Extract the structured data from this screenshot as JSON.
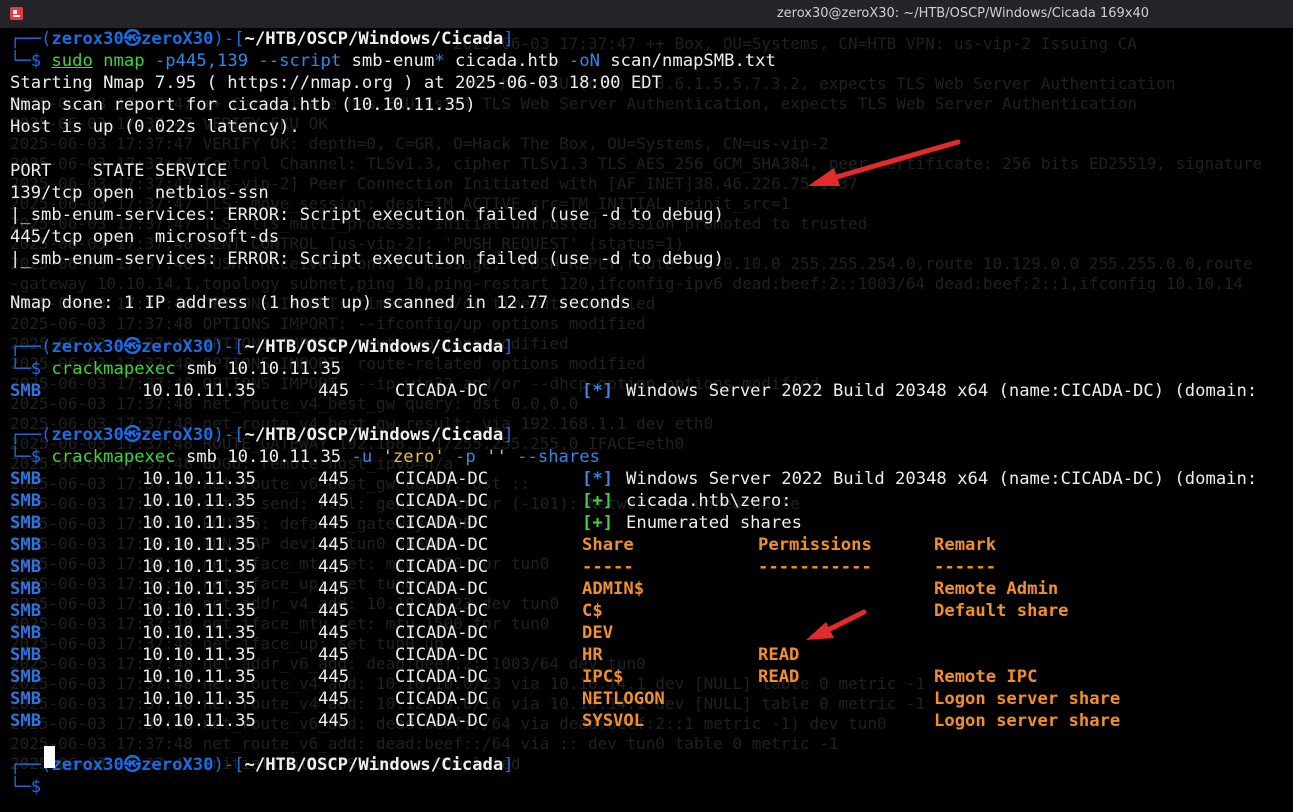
{
  "window": {
    "title": "zerox30@zeroX30: ~/HTB/OSCP/Windows/Cicada 169x40"
  },
  "prompt": {
    "open": "┌──(",
    "user": "zerox30㉿zeroX30",
    "mid": ")-[",
    "path": "~/HTB/OSCP/Windows/Cicada",
    "close": "]",
    "input": "└─$"
  },
  "block1": {
    "cmd_sudo": "sudo",
    "cmd_nmap": "nmap",
    "cmd_opt1": "-p445,139",
    "cmd_opt2": "--script",
    "cmd_arg1": "smb-enum",
    "cmd_glob": "*",
    "cmd_arg2": "cicada.htb",
    "cmd_opt3": "-oN",
    "cmd_arg3": "scan/nmapSMB.txt",
    "output": [
      "Starting Nmap 7.95 ( https://nmap.org ) at 2025-06-03 18:00 EDT",
      "Nmap scan report for cicada.htb (10.10.11.35)",
      "Host is up (0.022s latency).",
      "",
      "PORT    STATE SERVICE",
      "139/tcp open  netbios-ssn",
      "|_smb-enum-services: ERROR: Script execution failed (use -d to debug)",
      "445/tcp open  microsoft-ds",
      "|_smb-enum-services: ERROR: Script execution failed (use -d to debug)",
      "",
      "Nmap done: 1 IP address (1 host up) scanned in 12.77 seconds",
      ""
    ]
  },
  "block2": {
    "cmd_name": "crackmapexec",
    "cmd_args": "smb 10.10.11.35",
    "line": {
      "proto": "SMB",
      "ip": "10.10.11.35",
      "port": "445",
      "host": "CICADA-DC",
      "tag": "[*]",
      "msg": "Windows Server 2022 Build 20348 x64 (name:CICADA-DC) (domain:"
    }
  },
  "block3": {
    "cmd_name": "crackmapexec",
    "cmd_args": "smb 10.10.11.35",
    "cmd_opt_u": "-u",
    "cmd_user": "'zero'",
    "cmd_opt_p": "-p",
    "cmd_pass": "''",
    "cmd_opt_shares": "--shares",
    "proto": "SMB",
    "ip": "10.10.11.35",
    "port": "445",
    "host": "CICADA-DC",
    "info": [
      {
        "tag": "[*]",
        "msg": "Windows Server 2022 Build 20348 x64 (name:CICADA-DC) (domain:"
      },
      {
        "tag": "[+]",
        "msg": "cicada.htb\\zero:"
      },
      {
        "tag": "[+]",
        "msg": "Enumerated shares"
      }
    ],
    "headers": {
      "share": "Share",
      "perm": "Permissions",
      "remark": "Remark"
    },
    "dashes": {
      "share": "-----",
      "perm": "-----------",
      "remark": "------"
    },
    "shares": [
      {
        "name": "ADMIN$",
        "perm": "",
        "remark": "Remote Admin"
      },
      {
        "name": "C$",
        "perm": "",
        "remark": "Default share"
      },
      {
        "name": "DEV",
        "perm": "",
        "remark": ""
      },
      {
        "name": "HR",
        "perm": "READ",
        "remark": ""
      },
      {
        "name": "IPC$",
        "perm": "READ",
        "remark": "Remote IPC"
      },
      {
        "name": "NETLOGON",
        "perm": "",
        "remark": "Logon server share"
      },
      {
        "name": "SYSVOL",
        "perm": "",
        "remark": "Logon server share"
      }
    ]
  },
  "background_log": [
    "                                              2025-06-03 17:37:47 ++ Box, OU=Systems, CN=HTB VPN: us-vip-2 Issuing CA",
    "",
    "                                               ate has EKU (oid) 1.3.6.1.5.5.7.3.2, expects TLS Web Server Authentication",
    "2025-06-03 17:37:47 ++ Certificate has EKU (str) TLS Web Server Authentication, expects TLS Web Server Authentication",
    "2025-06-03 17:37:47 VERIFY EKU OK",
    "2025-06-03 17:37:47 VERIFY OK: depth=0, C=GR, O=Hack The Box, OU=Systems, CN=us-vip-2",
    "2025-06-03 17:37:47 Control Channel: TLSv1.3, cipher TLSv1.3 TLS_AES_256_GCM_SHA384, peer certificate: 256 bits ED25519, signature",
    "2025-06-03 17:37:47 [us-vip-2] Peer Connection Initiated with [AF_INET]38.46.226.75:1337",
    "2025-06-03 17:37:47 TLS: move_session: dest=TM_ACTIVE src=TM_INITIAL reinit_src=1",
    "2025-06-03 17:37:47 TLS: tls_multi_process: initial untrusted session promoted to trusted",
    "2025-06-03 17:37:48 SENT CONTROL [us-vip-2]: 'PUSH_REQUEST' (status=1)",
    "2025-06-03 17:37:48 PUSH: Received control message: 'PUSH_REPLY,route 10.10.10.0 255.255.254.0,route 10.129.0.0 255.255.0.0,route",
    "-gateway 10.10.14.1,topology subnet,ping 10,ping-restart 120,ifconfig-ipv6 dead:beef:2::1003/64 dead:beef:2::1,ifconfig 10.10.14",
    "2025-06-03 17:37:48 OPTIONS IMPORT: timers and/or timeouts modified",
    "2025-06-03 17:37:48 OPTIONS IMPORT: --ifconfig/up options modified",
    "2025-06-03 17:37:48 OPTIONS IMPORT: route options modified",
    "2025-06-03 17:37:48 OPTIONS IMPORT: route-related options modified",
    "2025-06-03 17:37:48 OPTIONS IMPORT: --ip-win32 and/or --dhcp-option options modified",
    "2025-06-03 17:37:48 net_route_v4_best_gw query: dst 0.0.0.0",
    "2025-06-03 17:37:48 net_route_v4_best_gw result: via 192.168.1.1 dev eth0",
    "2025-06-03 17:37:48 ROUTE_GATEWAY 192.168.1.1/255.255.255.0 IFACE=eth0",
    "2025-06-03 17:37:48 GDG6: remote_host_ipv6=n/a",
    "2025-06-03 17:37:48 net_route_v6_best_gw query: dst ::",
    "2025-06-03 17:37:48 sitnl_send: rtnl: generic error (-101): Network is unreachable",
    "2025-06-03 17:37:48 ROUTE6: default_gateway=UNDEF",
    "2025-06-03 17:37:48 TUN/TAP device tun0 opened",
    "2025-06-03 17:37:48 net_iface_mtu_set: mtu 1500 for tun0",
    "2025-06-03 17:37:48 net_iface_up: set tun0 up",
    "2025-06-03 17:37:48 net_addr_v4_add: 10.10.14.23 dev tun0",
    "2025-06-03 17:37:48 net_iface_mtu_set: mtu 1500 for tun0",
    "2025-06-03 17:37:48 net_iface_up: set tun0 up",
    "2025-06-03 17:37:48 net_addr_v6_add: dead:beef:2::1003/64 dev tun0",
    "2025-06-03 17:37:48 net_route_v4_add: 10.10.10.0/23 via 10.10.14.1 dev [NULL] table 0 metric -1",
    "2025-06-03 17:37:48 net_route_v4_add: 10.129.0.0/16 via 10.10.14.1 dev [NULL] table 0 metric -1",
    "2025-06-03 17:37:48 net_route_v6_add: dead:beef::/64 via dead:beef:2::1 metric -1) dev tun0",
    "2025-06-03 17:37:48 net_route_v6_add: dead:beef::/64 via :: dev tun0 table 0 metric -1",
    "2025-06-03 17:37:48 Initialization Sequence Completed"
  ],
  "colors": {
    "background": "#000000",
    "prompt": "#1d6de0",
    "command": "#3bd63b",
    "option": "#2f8ae8",
    "string": "#e9c32a",
    "smb_label": "#2f73df",
    "share_highlight": "#f08f2c",
    "arrow": "#e32b2b"
  },
  "annotations": {
    "arrow_count": 2
  }
}
